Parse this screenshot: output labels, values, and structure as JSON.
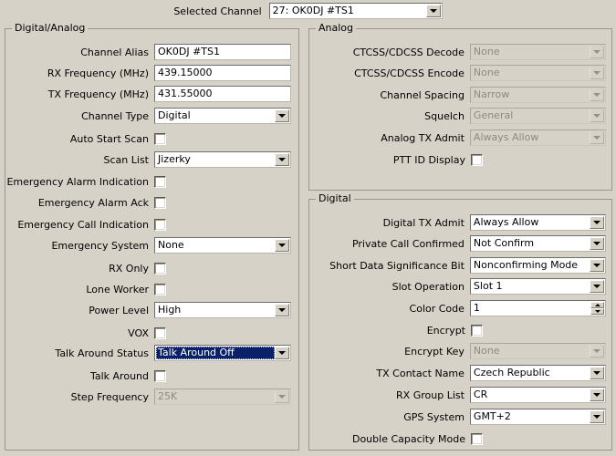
{
  "topbar": {
    "label": "Selected Channel",
    "selected_channel": "27: OK0DJ #TS1"
  },
  "digital_analog": {
    "title": "Digital/Analog",
    "fields": {
      "channel_alias": {
        "label": "Channel Alias",
        "value": "OK0DJ #TS1"
      },
      "rx_frequency": {
        "label": "RX Frequency (MHz)",
        "value": "439.15000"
      },
      "tx_frequency": {
        "label": "TX Frequency (MHz)",
        "value": "431.55000"
      },
      "channel_type": {
        "label": "Channel Type",
        "value": "Digital"
      },
      "auto_start_scan": {
        "label": "Auto Start Scan",
        "checked": false
      },
      "scan_list": {
        "label": "Scan List",
        "value": "Jizerky"
      },
      "emergency_alarm_indication": {
        "label": "Emergency Alarm Indication",
        "checked": false
      },
      "emergency_alarm_ack": {
        "label": "Emergency Alarm Ack",
        "checked": false
      },
      "emergency_call_indication": {
        "label": "Emergency Call Indication",
        "checked": false
      },
      "emergency_system": {
        "label": "Emergency System",
        "value": "None"
      },
      "rx_only": {
        "label": "RX Only",
        "checked": false
      },
      "lone_worker": {
        "label": "Lone Worker",
        "checked": false
      },
      "power_level": {
        "label": "Power Level",
        "value": "High"
      },
      "vox": {
        "label": "VOX",
        "checked": false
      },
      "talk_around_status": {
        "label": "Talk Around Status",
        "value": "Talk Around Off"
      },
      "talk_around": {
        "label": "Talk Around",
        "checked": false
      },
      "step_frequency": {
        "label": "Step Frequency",
        "value": "25K"
      }
    }
  },
  "analog": {
    "title": "Analog",
    "fields": {
      "ctcss_cdcss_decode": {
        "label": "CTCSS/CDCSS Decode",
        "value": "None"
      },
      "ctcss_cdcss_encode": {
        "label": "CTCSS/CDCSS Encode",
        "value": "None"
      },
      "channel_spacing": {
        "label": "Channel Spacing",
        "value": "Narrow"
      },
      "squelch": {
        "label": "Squelch",
        "value": "General"
      },
      "analog_tx_admit": {
        "label": "Analog TX Admit",
        "value": "Always Allow"
      },
      "ptt_id_display": {
        "label": "PTT ID Display",
        "checked": false
      }
    }
  },
  "digital": {
    "title": "Digital",
    "fields": {
      "digital_tx_admit": {
        "label": "Digital TX Admit",
        "value": "Always Allow"
      },
      "private_call_confirmed": {
        "label": "Private Call Confirmed",
        "value": "Not Confirm"
      },
      "short_data_significance_bit": {
        "label": "Short Data Significance Bit",
        "value": "Nonconfirming Mode"
      },
      "slot_operation": {
        "label": "Slot Operation",
        "value": "Slot 1"
      },
      "color_code": {
        "label": "Color Code",
        "value": "1"
      },
      "encrypt": {
        "label": "Encrypt",
        "checked": false
      },
      "encrypt_key": {
        "label": "Encrypt Key",
        "value": "None"
      },
      "tx_contact_name": {
        "label": "TX Contact Name",
        "value": "Czech Republic"
      },
      "rx_group_list": {
        "label": "RX Group List",
        "value": "CR"
      },
      "gps_system": {
        "label": "GPS System",
        "value": "GMT+2"
      },
      "double_capacity_mode": {
        "label": "Double Capacity Mode",
        "checked": false
      }
    }
  },
  "colors": {
    "window_background": "#d6d2c8",
    "field_background": "#ffffff",
    "selection_background": "#0a2069",
    "selection_text": "#ffffff",
    "disabled_text": "#8e8a82",
    "group_border": "#9a968d"
  }
}
